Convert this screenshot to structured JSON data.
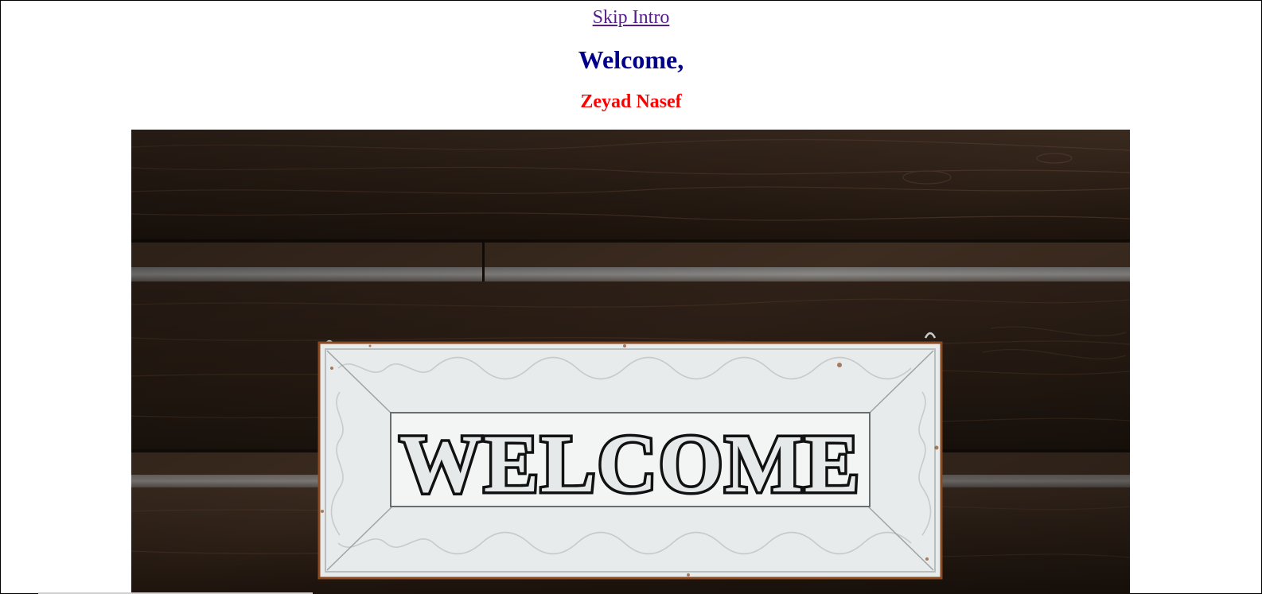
{
  "nav": {
    "skip_intro": "Skip Intro"
  },
  "greeting": {
    "title": "Welcome,",
    "name": "Zeyad Nasef"
  },
  "hero": {
    "sign_text": "WELCOME",
    "colors": {
      "wood_dark": "#23170f",
      "wood_mid": "#3b2a1e",
      "wood_light": "#5a4233",
      "sign_frame": "#e9ecec",
      "sign_panel": "#f2f4f4",
      "sign_letters": "#141414",
      "rust": "#8a4a22"
    }
  },
  "colors": {
    "title": "#00008b",
    "name": "#ff0000",
    "link": "#551a8b"
  }
}
